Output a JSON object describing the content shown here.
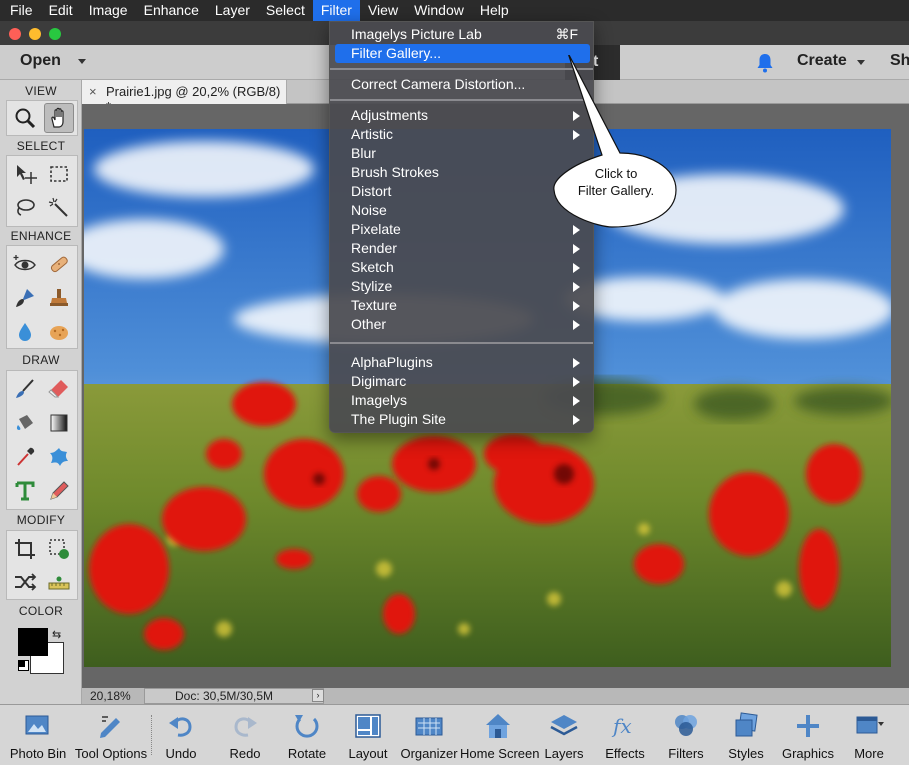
{
  "menubar": {
    "items": [
      "File",
      "Edit",
      "Image",
      "Enhance",
      "Layer",
      "Select",
      "Filter",
      "View",
      "Window",
      "Help"
    ],
    "active": "Filter"
  },
  "appbar": {
    "open_label": "Open",
    "dark_tab_label": "t",
    "create_label": "Create",
    "share_label": "Sh"
  },
  "toolbox": {
    "sections": [
      "VIEW",
      "SELECT",
      "ENHANCE",
      "DRAW",
      "MODIFY",
      "COLOR"
    ],
    "tools": {
      "view": [
        "zoom-tool",
        "hand-tool"
      ],
      "select": [
        "move-tool",
        "marquee-tool",
        "lasso-tool",
        "quick-selection-tool"
      ],
      "enhance": [
        "red-eye-tool",
        "spot-healing-tool",
        "smart-brush-tool",
        "clone-stamp-tool",
        "blur-tool",
        "sponge-tool"
      ],
      "draw": [
        "brush-tool",
        "eraser-tool",
        "paint-bucket-tool",
        "gradient-tool",
        "color-picker-tool",
        "custom-shape-tool",
        "type-tool",
        "pencil-tool"
      ],
      "modify": [
        "crop-tool",
        "recompose-tool",
        "content-aware-move-tool",
        "straighten-tool"
      ]
    },
    "selected_tool": "hand-tool"
  },
  "document": {
    "tab_label": "Prairie1.jpg @ 20,2% (RGB/8) *",
    "close_glyph": "×"
  },
  "status": {
    "zoom": "20,18%",
    "doc_size": "Doc: 30,5M/30,5M"
  },
  "filter_menu": {
    "groups": [
      [
        {
          "label": "Imagelys Picture Lab",
          "shortcut": "⌘F"
        },
        {
          "label": "Filter Gallery...",
          "highlighted": true
        }
      ],
      [
        {
          "label": "Correct Camera Distortion..."
        }
      ],
      [
        {
          "label": "Adjustments",
          "submenu": true
        },
        {
          "label": "Artistic",
          "submenu": true
        },
        {
          "label": "Blur"
        },
        {
          "label": "Brush Strokes"
        },
        {
          "label": "Distort"
        },
        {
          "label": "Noise"
        },
        {
          "label": "Pixelate",
          "submenu": true
        },
        {
          "label": "Render",
          "submenu": true
        },
        {
          "label": "Sketch",
          "submenu": true
        },
        {
          "label": "Stylize",
          "submenu": true
        },
        {
          "label": "Texture",
          "submenu": true
        },
        {
          "label": "Other",
          "submenu": true
        }
      ],
      [
        {
          "label": "AlphaPlugins",
          "submenu": true
        },
        {
          "label": "Digimarc",
          "submenu": true
        },
        {
          "label": "Imagelys",
          "submenu": true
        },
        {
          "label": "The Plugin Site",
          "submenu": true
        }
      ]
    ]
  },
  "callout": {
    "line1": "Click to",
    "line2": "Filter Gallery."
  },
  "bottombar": {
    "items": [
      {
        "label": "Photo Bin",
        "icon": "photo-bin-icon"
      },
      {
        "label": "Tool Options",
        "icon": "tool-options-icon"
      },
      {
        "label": "Undo",
        "icon": "undo-icon"
      },
      {
        "label": "Redo",
        "icon": "redo-icon"
      },
      {
        "label": "Rotate",
        "icon": "rotate-icon"
      },
      {
        "label": "Layout",
        "icon": "layout-icon"
      },
      {
        "label": "Organizer",
        "icon": "organizer-icon"
      },
      {
        "label": "Home Screen",
        "icon": "home-screen-icon"
      },
      {
        "label": "Layers",
        "icon": "layers-icon"
      },
      {
        "label": "Effects",
        "icon": "effects-icon"
      },
      {
        "label": "Filters",
        "icon": "filters-icon"
      },
      {
        "label": "Styles",
        "icon": "styles-icon"
      },
      {
        "label": "Graphics",
        "icon": "graphics-icon"
      },
      {
        "label": "More",
        "icon": "more-icon"
      }
    ]
  },
  "colors": {
    "menu_highlight": "#1f6feb",
    "foreground_swatch": "#000000",
    "background_swatch": "#ffffff"
  }
}
